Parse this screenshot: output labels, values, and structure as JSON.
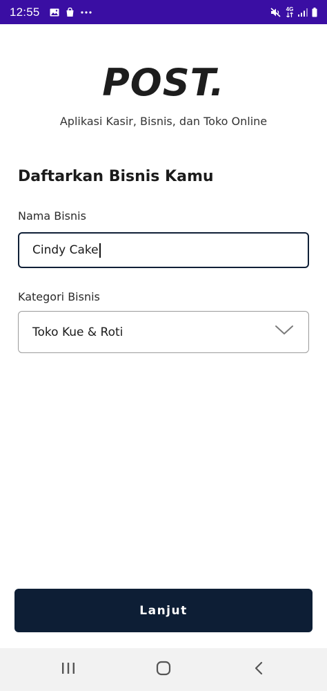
{
  "status_bar": {
    "time": "12:55",
    "icons_left": [
      "image-icon",
      "bag-icon",
      "more-icon"
    ],
    "network_label": "4G",
    "icons_right": [
      "mute-icon",
      "network-icon",
      "signal-icon",
      "battery-icon"
    ],
    "background_color": "#3a0ea3"
  },
  "header": {
    "logo": "POST.",
    "tagline": "Aplikasi Kasir, Bisnis, dan Toko Online"
  },
  "form": {
    "title": "Daftarkan Bisnis Kamu",
    "business_name": {
      "label": "Nama Bisnis",
      "value": "Cindy Cake"
    },
    "business_category": {
      "label": "Kategori Bisnis",
      "selected": "Toko Kue & Roti"
    }
  },
  "actions": {
    "next_label": "Lanjut",
    "button_color": "#0d1e35"
  },
  "nav_bar": {
    "buttons": [
      "recent-apps-icon",
      "home-icon",
      "back-icon"
    ]
  }
}
